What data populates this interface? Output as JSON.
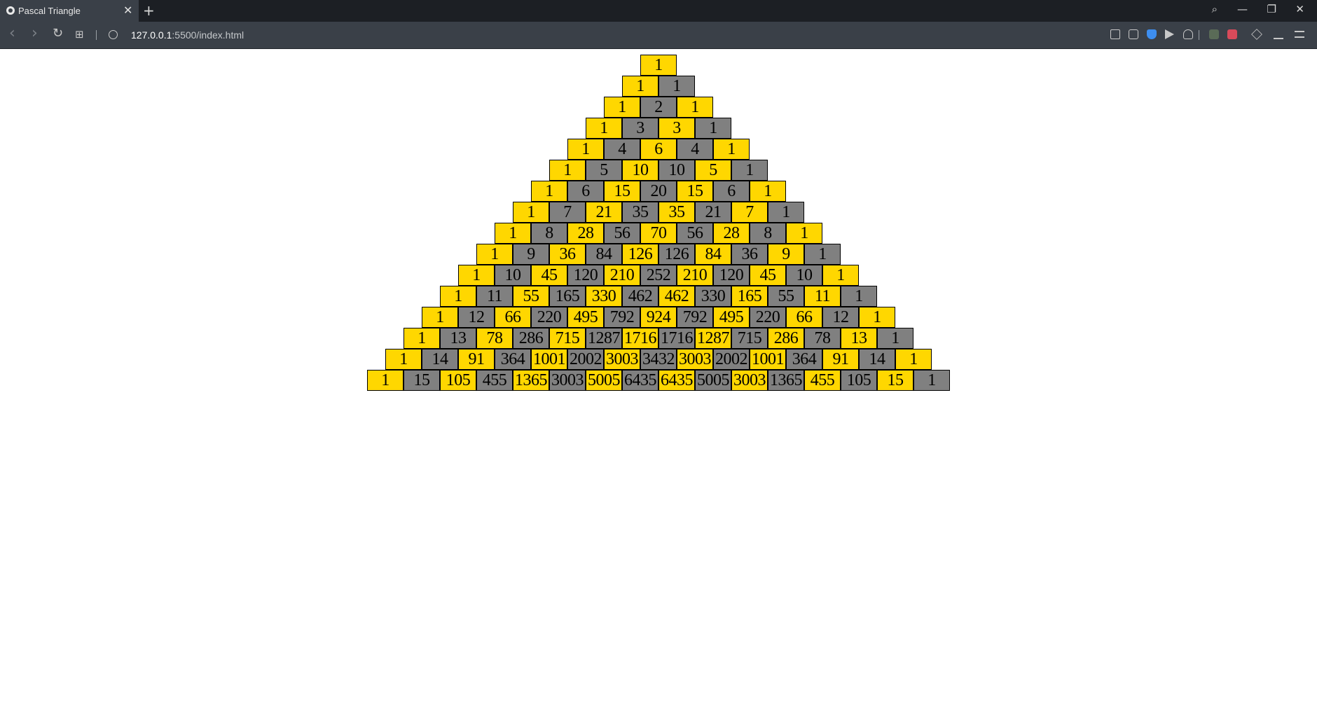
{
  "browser": {
    "tab_title": "Pascal Triangle",
    "tab_close": "✕",
    "new_tab": "+",
    "url_host": "127.0.0.1",
    "url_rest": ":5500/index.html",
    "nav": {
      "back": "‹",
      "forward": "›",
      "reload": "↻",
      "tabs": "⊞"
    },
    "window": {
      "search": "⌕",
      "minimize": "—",
      "restore": "❐",
      "close": "✕"
    }
  },
  "colors": {
    "even_cell": "#ffd700",
    "odd_cell": "#808080"
  },
  "triangle": [
    [
      "1"
    ],
    [
      "1",
      "1"
    ],
    [
      "1",
      "2",
      "1"
    ],
    [
      "1",
      "3",
      "3",
      "1"
    ],
    [
      "1",
      "4",
      "6",
      "4",
      "1"
    ],
    [
      "1",
      "5",
      "10",
      "10",
      "5",
      "1"
    ],
    [
      "1",
      "6",
      "15",
      "20",
      "15",
      "6",
      "1"
    ],
    [
      "1",
      "7",
      "21",
      "35",
      "35",
      "21",
      "7",
      "1"
    ],
    [
      "1",
      "8",
      "28",
      "56",
      "70",
      "56",
      "28",
      "8",
      "1"
    ],
    [
      "1",
      "9",
      "36",
      "84",
      "126",
      "126",
      "84",
      "36",
      "9",
      "1"
    ],
    [
      "1",
      "10",
      "45",
      "120",
      "210",
      "252",
      "210",
      "120",
      "45",
      "10",
      "1"
    ],
    [
      "1",
      "11",
      "55",
      "165",
      "330",
      "462",
      "462",
      "330",
      "165",
      "55",
      "11",
      "1"
    ],
    [
      "1",
      "12",
      "66",
      "220",
      "495",
      "792",
      "924",
      "792",
      "495",
      "220",
      "66",
      "12",
      "1"
    ],
    [
      "1",
      "13",
      "78",
      "286",
      "715",
      "1287",
      "1716",
      "1716",
      "1287",
      "715",
      "286",
      "78",
      "13",
      "1"
    ],
    [
      "1",
      "14",
      "91",
      "364",
      "1001",
      "2002",
      "3003",
      "3432",
      "3003",
      "2002",
      "1001",
      "364",
      "91",
      "14",
      "1"
    ],
    [
      "1",
      "15",
      "105",
      "455",
      "1365",
      "3003",
      "5005",
      "6435",
      "6435",
      "5005",
      "3003",
      "1365",
      "455",
      "105",
      "15",
      "1"
    ]
  ]
}
